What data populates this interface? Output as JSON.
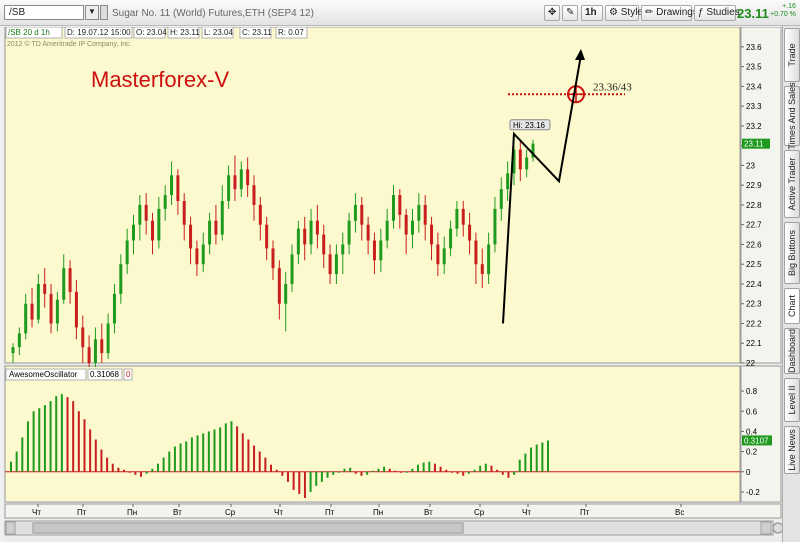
{
  "toolbar": {
    "symbol": "/SB",
    "description": "Sugar No. 11 (World)  Futures,ETH (SEP4 12)",
    "timeframe": "1h",
    "style_label": "Style",
    "drawings_label": "Drawings",
    "studies_label": "Studies",
    "last_price": "23.11",
    "change": "+.16",
    "change_pct": "+0.70 %"
  },
  "side_tabs": [
    "Trade",
    "Times And Sales",
    "Active Trader",
    "Big Buttons",
    "Chart",
    "Dashboard",
    "Level II",
    "Live News"
  ],
  "colors": {
    "up": "#1f9a1f",
    "down": "#c81e1e",
    "bg": "#fbf9cd",
    "annot": "#cc1010"
  },
  "chart_data": [
    {
      "type": "candlestick",
      "title": "Masterforex-V",
      "header": {
        "symbol": "/SB 20 d 1h",
        "D": "D: 19.07.12 15:00",
        "O": "O: 23.04",
        "H": "H: 23.11",
        "L": "L: 23.04",
        "C": "C: 23.11",
        "R": "R: 0.07"
      },
      "copyright": "2012 © TD Ameritrade IP Company, Inc.",
      "y_ticks": [
        "23.6",
        "23.5",
        "23.4",
        "23.3",
        "23.2",
        "23.1",
        "23",
        "22.9",
        "22.8",
        "22.7",
        "22.6",
        "22.5",
        "22.4",
        "22.3",
        "22.2",
        "22.1",
        "22"
      ],
      "ylim": [
        22.0,
        23.65
      ],
      "x_ticks": [
        "Чт",
        "Пт",
        "Пн",
        "Вт",
        "Ср",
        "Чт",
        "Пт",
        "Пн",
        "Вт",
        "Ср",
        "Чт",
        "Пт",
        "Вс"
      ],
      "last_price_label": "23.11",
      "high_label": "Hi: 23.16",
      "target_label": "23.36/43",
      "target_level": 23.36,
      "candles": [
        [
          22.05,
          22.08,
          22.0,
          22.1
        ],
        [
          22.08,
          22.15,
          22.04,
          22.18
        ],
        [
          22.15,
          22.3,
          22.12,
          22.35
        ],
        [
          22.3,
          22.22,
          22.18,
          22.38
        ],
        [
          22.22,
          22.4,
          22.2,
          22.45
        ],
        [
          22.4,
          22.35,
          22.28,
          22.48
        ],
        [
          22.35,
          22.2,
          22.15,
          22.4
        ],
        [
          22.2,
          22.32,
          22.16,
          22.36
        ],
        [
          22.32,
          22.48,
          22.3,
          22.55
        ],
        [
          22.48,
          22.36,
          22.3,
          22.52
        ],
        [
          22.36,
          22.18,
          22.12,
          22.42
        ],
        [
          22.18,
          22.08,
          22.0,
          22.24
        ],
        [
          22.08,
          22.0,
          21.98,
          22.14
        ],
        [
          22.0,
          22.12,
          21.98,
          22.18
        ],
        [
          22.12,
          22.05,
          22.0,
          22.2
        ],
        [
          22.05,
          22.2,
          22.02,
          22.25
        ],
        [
          22.2,
          22.35,
          22.15,
          22.4
        ],
        [
          22.35,
          22.5,
          22.3,
          22.55
        ],
        [
          22.5,
          22.62,
          22.45,
          22.68
        ],
        [
          22.62,
          22.7,
          22.55,
          22.75
        ],
        [
          22.7,
          22.8,
          22.62,
          22.85
        ],
        [
          22.8,
          22.72,
          22.65,
          22.86
        ],
        [
          22.72,
          22.62,
          22.55,
          22.76
        ],
        [
          22.62,
          22.78,
          22.58,
          22.84
        ],
        [
          22.78,
          22.85,
          22.72,
          22.9
        ],
        [
          22.85,
          22.95,
          22.8,
          23.02
        ],
        [
          22.95,
          22.82,
          22.75,
          22.98
        ],
        [
          22.82,
          22.7,
          22.62,
          22.86
        ],
        [
          22.7,
          22.58,
          22.5,
          22.74
        ],
        [
          22.58,
          22.5,
          22.44,
          22.62
        ],
        [
          22.5,
          22.6,
          22.46,
          22.66
        ],
        [
          22.6,
          22.72,
          22.55,
          22.76
        ],
        [
          22.72,
          22.65,
          22.6,
          22.8
        ],
        [
          22.65,
          22.82,
          22.62,
          22.9
        ],
        [
          22.82,
          22.95,
          22.78,
          23.0
        ],
        [
          22.95,
          22.88,
          22.82,
          23.05
        ],
        [
          22.88,
          22.98,
          22.84,
          23.02
        ],
        [
          22.98,
          22.9,
          22.84,
          23.04
        ],
        [
          22.9,
          22.8,
          22.72,
          22.95
        ],
        [
          22.8,
          22.7,
          22.62,
          22.84
        ],
        [
          22.7,
          22.58,
          22.52,
          22.74
        ],
        [
          22.58,
          22.48,
          22.42,
          22.62
        ],
        [
          22.48,
          22.3,
          22.22,
          22.52
        ],
        [
          22.3,
          22.4,
          22.16,
          22.46
        ],
        [
          22.4,
          22.55,
          22.36,
          22.6
        ],
        [
          22.55,
          22.68,
          22.5,
          22.72
        ],
        [
          22.68,
          22.6,
          22.52,
          22.74
        ],
        [
          22.6,
          22.72,
          22.55,
          22.78
        ],
        [
          22.72,
          22.65,
          22.58,
          22.8
        ],
        [
          22.65,
          22.55,
          22.48,
          22.7
        ],
        [
          22.55,
          22.45,
          22.4,
          22.6
        ],
        [
          22.45,
          22.55,
          22.4,
          22.6
        ],
        [
          22.55,
          22.6,
          22.45,
          22.66
        ],
        [
          22.6,
          22.72,
          22.55,
          22.76
        ],
        [
          22.72,
          22.8,
          22.66,
          22.86
        ],
        [
          22.8,
          22.7,
          22.62,
          22.84
        ],
        [
          22.7,
          22.62,
          22.55,
          22.74
        ],
        [
          22.62,
          22.52,
          22.45,
          22.66
        ],
        [
          22.52,
          22.62,
          22.46,
          22.68
        ],
        [
          22.62,
          22.72,
          22.58,
          22.78
        ],
        [
          22.72,
          22.85,
          22.68,
          22.9
        ],
        [
          22.85,
          22.75,
          22.68,
          22.88
        ],
        [
          22.75,
          22.65,
          22.55,
          22.78
        ],
        [
          22.65,
          22.72,
          22.58,
          22.78
        ],
        [
          22.72,
          22.8,
          22.66,
          22.86
        ],
        [
          22.8,
          22.7,
          22.62,
          22.85
        ],
        [
          22.7,
          22.6,
          22.52,
          22.74
        ],
        [
          22.6,
          22.5,
          22.44,
          22.66
        ],
        [
          22.5,
          22.58,
          22.45,
          22.64
        ],
        [
          22.58,
          22.68,
          22.54,
          22.72
        ],
        [
          22.68,
          22.78,
          22.64,
          22.82
        ],
        [
          22.78,
          22.7,
          22.64,
          22.82
        ],
        [
          22.7,
          22.62,
          22.55,
          22.76
        ],
        [
          22.62,
          22.5,
          22.4,
          22.66
        ],
        [
          22.5,
          22.45,
          22.38,
          22.58
        ],
        [
          22.45,
          22.6,
          22.4,
          22.66
        ],
        [
          22.6,
          22.78,
          22.56,
          22.84
        ],
        [
          22.78,
          22.88,
          22.72,
          22.94
        ],
        [
          22.88,
          22.96,
          22.82,
          23.02
        ],
        [
          22.96,
          23.08,
          22.9,
          23.16
        ],
        [
          23.08,
          22.98,
          22.92,
          23.12
        ],
        [
          22.98,
          23.04,
          22.94,
          23.08
        ],
        [
          23.04,
          23.11,
          23.02,
          23.13
        ]
      ]
    },
    {
      "type": "bar",
      "title": "AwesomeOscillator",
      "value_label": "0.31068",
      "zero_label": "0",
      "last_label": "0.3107",
      "y_ticks": [
        "0.8",
        "0.6",
        "0.4",
        "0.2",
        "0",
        "-0.2"
      ],
      "ylim": [
        -0.3,
        0.9
      ],
      "values": [
        0.1,
        0.2,
        0.34,
        0.5,
        0.6,
        0.63,
        0.66,
        0.7,
        0.75,
        0.77,
        0.74,
        0.7,
        0.6,
        0.52,
        0.42,
        0.32,
        0.22,
        0.14,
        0.08,
        0.04,
        0.02,
        0.0,
        -0.03,
        -0.05,
        -0.02,
        0.03,
        0.08,
        0.14,
        0.2,
        0.25,
        0.28,
        0.3,
        0.34,
        0.36,
        0.38,
        0.4,
        0.42,
        0.44,
        0.48,
        0.5,
        0.45,
        0.38,
        0.32,
        0.26,
        0.2,
        0.14,
        0.07,
        0.02,
        -0.04,
        -0.1,
        -0.18,
        -0.22,
        -0.26,
        -0.2,
        -0.14,
        -0.1,
        -0.06,
        -0.03,
        0.0,
        0.03,
        0.04,
        -0.02,
        -0.04,
        -0.03,
        0.01,
        0.03,
        0.05,
        0.03,
        0.01,
        -0.01,
        0.0,
        0.03,
        0.07,
        0.09,
        0.1,
        0.08,
        0.05,
        0.02,
        0.0,
        -0.02,
        -0.04,
        -0.02,
        0.02,
        0.06,
        0.08,
        0.06,
        0.02,
        -0.03,
        -0.06,
        -0.03,
        0.12,
        0.18,
        0.24,
        0.27,
        0.29,
        0.31
      ]
    }
  ]
}
